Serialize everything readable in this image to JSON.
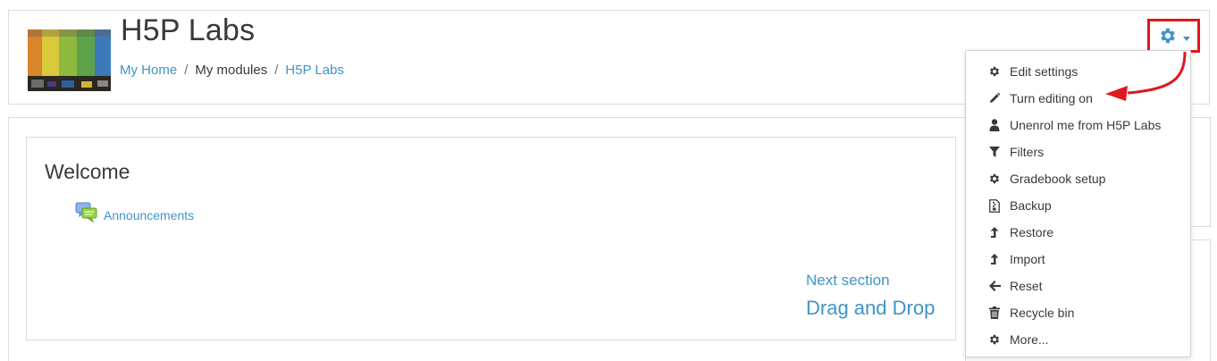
{
  "header": {
    "title": "H5P Labs",
    "breadcrumb": [
      {
        "label": "My Home",
        "link": true
      },
      {
        "label": "My modules",
        "link": false
      },
      {
        "label": "H5P Labs",
        "link": true
      }
    ],
    "breadcrumb_separator": "/"
  },
  "settings_menu": {
    "trigger_icon": "gear-icon",
    "accent_color": "#3f94c8",
    "highlight_color": "#e0171f",
    "items": [
      {
        "label": "Edit settings",
        "icon": "gear-icon"
      },
      {
        "label": "Turn editing on",
        "icon": "pencil-icon"
      },
      {
        "label": "Unenrol me from H5P Labs",
        "icon": "user-icon"
      },
      {
        "label": "Filters",
        "icon": "filter-icon"
      },
      {
        "label": "Gradebook setup",
        "icon": "gear-icon"
      },
      {
        "label": "Backup",
        "icon": "file-zip-icon"
      },
      {
        "label": "Restore",
        "icon": "level-up-icon"
      },
      {
        "label": "Import",
        "icon": "level-up-icon"
      },
      {
        "label": "Reset",
        "icon": "arrow-left-icon"
      },
      {
        "label": "Recycle bin",
        "icon": "trash-icon"
      },
      {
        "label": "More...",
        "icon": "gear-icon"
      }
    ]
  },
  "section": {
    "title": "Welcome",
    "activities": [
      {
        "label": "Announcements",
        "icon": "forum-icon"
      }
    ],
    "next_section_label": "Next section",
    "next_section_name": "Drag and Drop"
  }
}
